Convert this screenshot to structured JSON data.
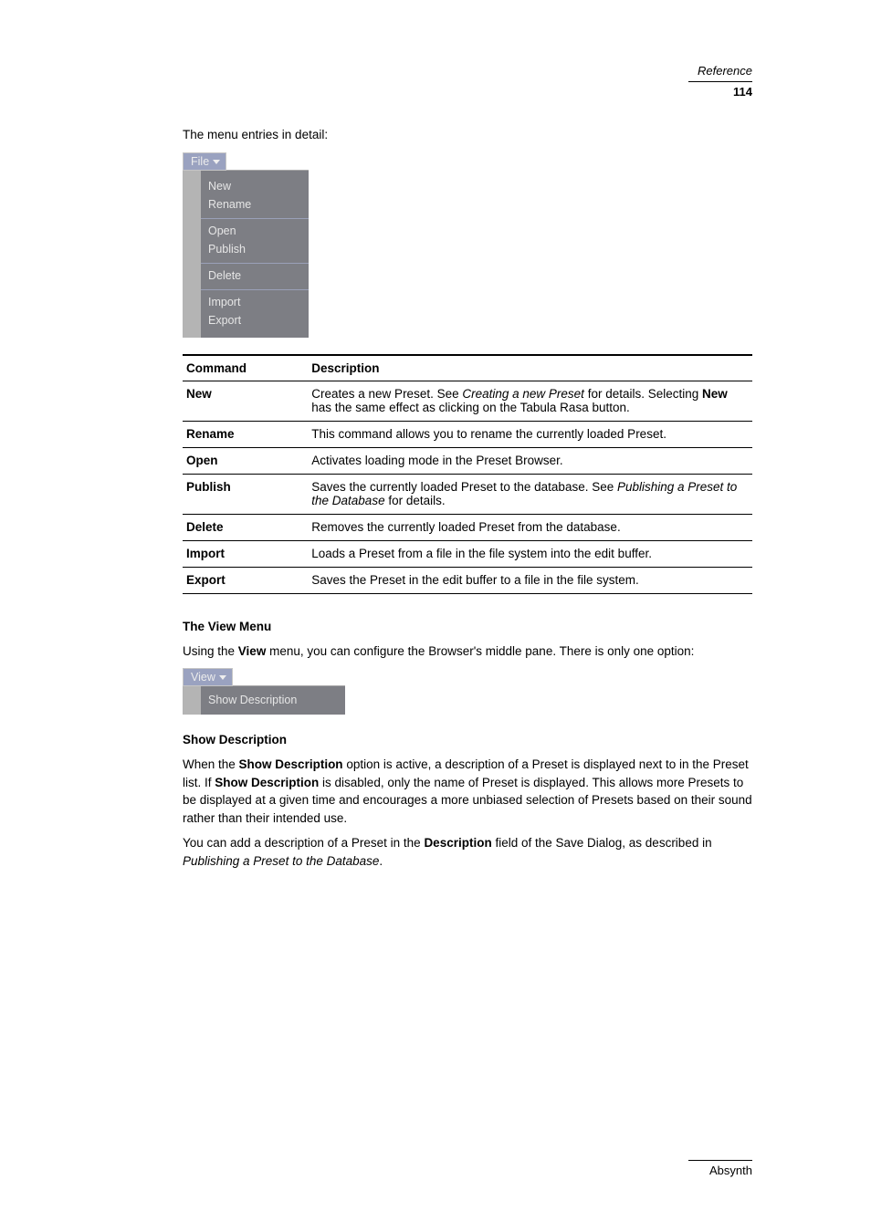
{
  "header": {
    "title": "Reference",
    "page_number": "114"
  },
  "intro": "The menu entries in detail:",
  "file_menu": {
    "tab": "File",
    "groups": [
      [
        "New",
        "Rename"
      ],
      [
        "Open",
        "Publish"
      ],
      [
        "Delete"
      ],
      [
        "Import",
        "Export"
      ]
    ]
  },
  "table": {
    "headers": [
      "Command",
      "Description"
    ],
    "rows": [
      {
        "cmd": "New",
        "desc_prefix": "Creates a new Preset. See ",
        "ref": "Creating a new Preset",
        "ref_suffix": " for details. Selecting ",
        "bold": "New",
        "suffix": " has the same effect as clicking on the Tabula Rasa button."
      },
      {
        "cmd": "Rename",
        "desc": "This command allows you to rename the currently loaded Preset."
      },
      {
        "cmd": "Open",
        "desc": "Activates loading mode in the Preset Browser."
      },
      {
        "cmd": "Publish",
        "desc_prefix": "Saves the currently loaded Preset to the database. See ",
        "ref": "Publishing a Preset to the Database",
        "ref_suffix": " for details."
      },
      {
        "cmd": "Delete",
        "desc": "Removes the currently loaded Preset from the database."
      },
      {
        "cmd": "Import",
        "desc": "Loads a Preset from a file in the file system into the edit buffer."
      },
      {
        "cmd": "Export",
        "desc": "Saves the Preset in the edit buffer to a file in the file system."
      }
    ]
  },
  "view_section": {
    "title": "The View Menu",
    "text_prefix": "Using the ",
    "bold": "View",
    "text_suffix": " menu, you can configure the Browser's middle pane. There is only one option:"
  },
  "view_menu": {
    "tab": "View",
    "item": "Show Description"
  },
  "show_desc": {
    "title": "Show Description",
    "para1_prefix": "When the ",
    "para1_bold": "Show Description",
    "para1_middle": " option is active, a description of a Preset is displayed next to in the Preset list. If ",
    "para1_bold2": "Show Description",
    "para1_suffix": " is disabled, only the name of Preset is displayed. This allows more Presets to be displayed at a given time and encourages a more unbiased selection of Presets based on their sound rather than their intended use.",
    "para2_prefix": "You can add a description of a Preset in the ",
    "para2_bold": "Description",
    "para2_middle": " field of the Save Dialog, as described in ",
    "para2_ref": "Publishing a Preset to the Database",
    "para2_suffix": "."
  },
  "footer": {
    "text": "Absynth"
  }
}
